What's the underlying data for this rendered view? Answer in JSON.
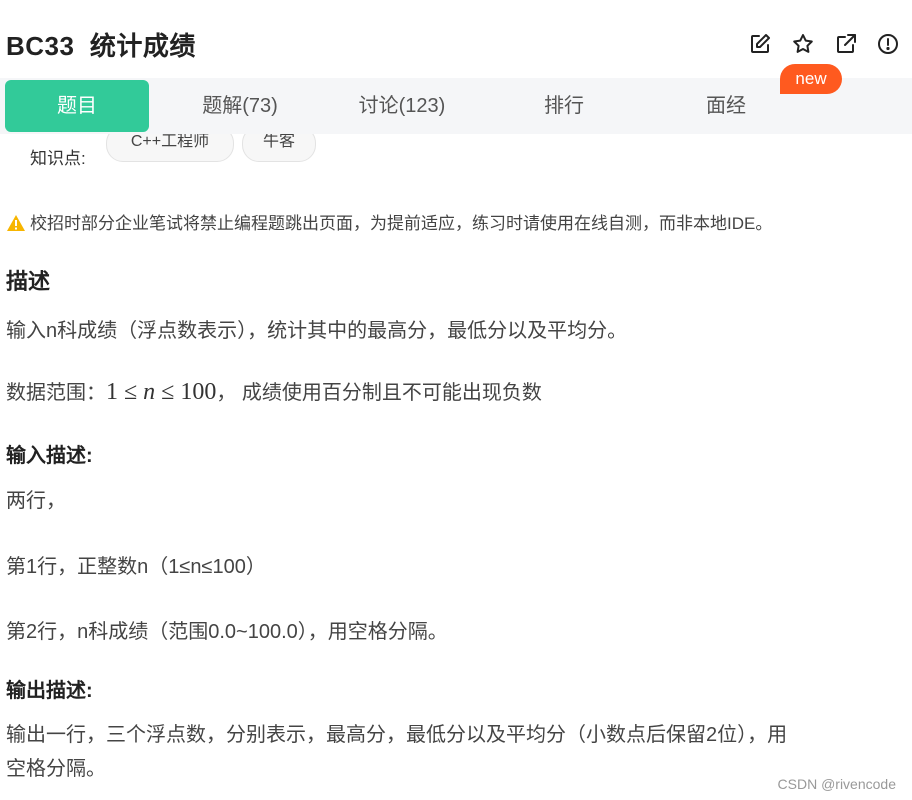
{
  "header": {
    "title": "BC33  统计成绩",
    "icons": [
      "edit-icon",
      "star-icon",
      "share-icon",
      "report-icon"
    ]
  },
  "tabs": [
    {
      "label": "题目",
      "active": true
    },
    {
      "label": "题解(73)",
      "active": false
    },
    {
      "label": "讨论(123)",
      "active": false
    },
    {
      "label": "排行",
      "active": false
    },
    {
      "label": "面经",
      "active": false
    }
  ],
  "new_badge": "new",
  "knowledge": {
    "label": "知识点:",
    "tags": [
      "C++工程师",
      "牛客"
    ]
  },
  "notice": "校招时部分企业笔试将禁止编程题跳出页面，为提前适应，练习时请使用在线自测，而非本地IDE。",
  "description": {
    "heading": "描述",
    "line1": "输入n科成绩（浮点数表示），统计其中的最高分，最低分以及平均分。",
    "range_prefix": "数据范围：",
    "range_math": {
      "low": "1",
      "leq": "≤",
      "var": "n",
      "high": "100"
    },
    "range_suffix": "，  成绩使用百分制且不可能出现负数"
  },
  "input_desc": {
    "heading": "输入描述:",
    "lines": [
      "两行，",
      "第1行，正整数n（1≤n≤100）",
      "第2行，n科成绩（范围0.0~100.0），用空格分隔。"
    ]
  },
  "output_desc": {
    "heading": "输出描述:",
    "line1": "输出一行，三个浮点数，分别表示，最高分，最低分以及平均分（小数点后保留2位），用",
    "line2": "空格分隔。"
  },
  "watermark": "CSDN @rivencode",
  "colors": {
    "accent": "#32ca99",
    "badge": "#ff5a1f",
    "warning": "#f7b500"
  }
}
